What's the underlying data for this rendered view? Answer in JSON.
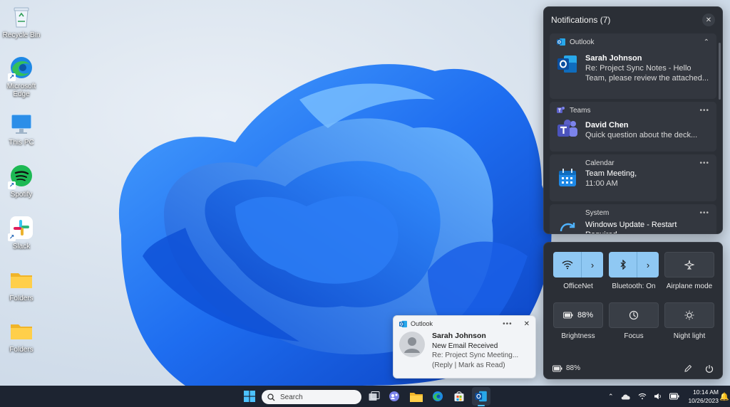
{
  "desktop": {
    "icons": [
      {
        "label": "Recycle Bin"
      },
      {
        "label": "Microsoft Edge"
      },
      {
        "label": "This PC"
      },
      {
        "label": "Spotify"
      },
      {
        "label": "Slack"
      },
      {
        "label": "Folders"
      },
      {
        "label": "Folders"
      }
    ]
  },
  "notifications": {
    "title": "Notifications (7)",
    "items": [
      {
        "app": "Outlook",
        "sender": "Sarah Johnson",
        "message": "Re: Project Sync Notes - Hello Team, please review the attached..."
      },
      {
        "app": "Teams",
        "sender": "David Chen",
        "message": "Quick question about the deck..."
      },
      {
        "app": "Calendar",
        "sender": "Team Meeting,",
        "message": "11:00 AM"
      },
      {
        "app": "System",
        "sender": "",
        "message": "Windows Update - Restart Required"
      }
    ]
  },
  "quick_settings": {
    "tiles": [
      {
        "label": "OfficeNet",
        "state": "on"
      },
      {
        "label": "Bluetooth: On",
        "state": "on"
      },
      {
        "label": "Airplane mode",
        "state": "off"
      },
      {
        "label": "Brightness",
        "value": "88%",
        "state": "off"
      },
      {
        "label": "Focus",
        "state": "off"
      },
      {
        "label": "Night light",
        "state": "off"
      }
    ],
    "battery": "88%"
  },
  "toast": {
    "app": "Outlook",
    "sender": "Sarah Johnson",
    "subject": "New Email Received",
    "preview": "Re: Project Sync Meeting...",
    "actions": "(Reply | Mark as Read)"
  },
  "taskbar": {
    "search_placeholder": "Search",
    "time": "10:14 AM",
    "date": "10/26/2023"
  },
  "colors": {
    "accent": "#8fc8f3",
    "panel": "#2b2f36",
    "taskbar": "#1d2431",
    "outlook_blue": "#0f6cbd",
    "teams_purple": "#5b5fc7"
  }
}
